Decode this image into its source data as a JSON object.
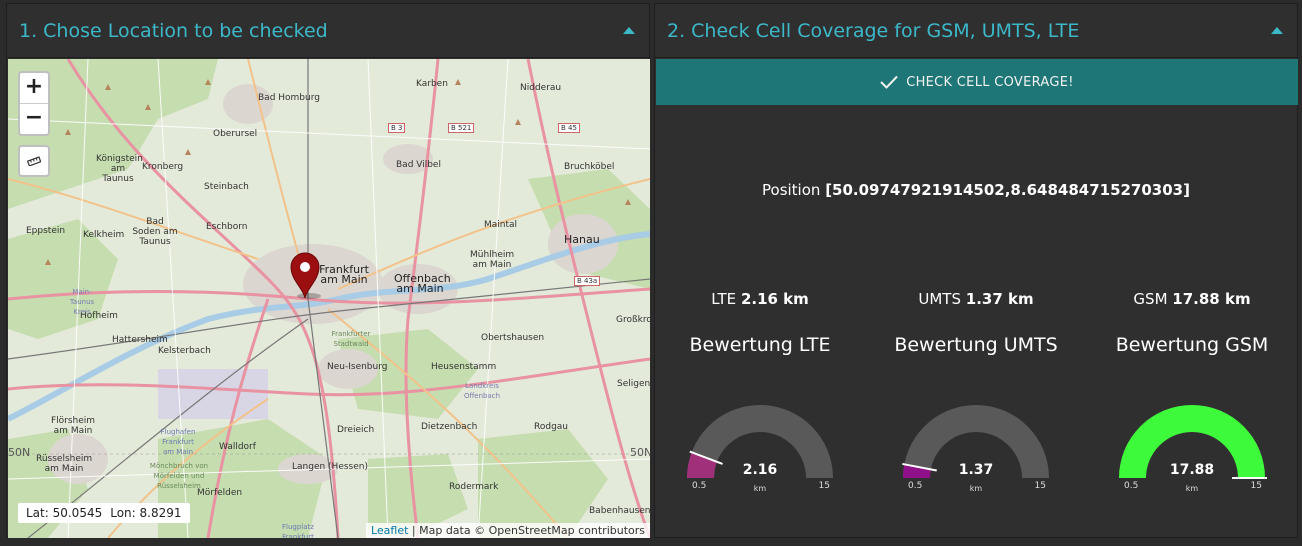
{
  "left_panel": {
    "title": "1. Chose Location to be checked",
    "zoom_in": "+",
    "zoom_out": "−",
    "coords": {
      "lat_label": "Lat: 50.0545",
      "lon_label": "Lon: 8.8291"
    },
    "attribution": {
      "link": "Leaflet",
      "text": "| Map data © OpenStreetMap contributors"
    },
    "map_labels": [
      "Karben",
      "Nidderau",
      "Bad Homburg",
      "Oberursel",
      "Königstein am Taunus",
      "Kronberg",
      "Bad Vilbel",
      "Bruchköbel",
      "Steinbach",
      "Eschborn",
      "Bad Soden am Taunus",
      "Eppstein",
      "Kelkheim",
      "Maintal",
      "Hanau",
      "Frankfurt am Main",
      "Offenbach am Main",
      "Mühlheim am Main",
      "Hofheim",
      "Hattersheim",
      "Kelsterbach",
      "Obertshausen",
      "Großkrotz",
      "Neu-Isenburg",
      "Heusenstamm",
      "Seligenstadt",
      "Flörsheim am Main",
      "Rüsselsheim am Main",
      "Walldorf",
      "Dreieich",
      "Dietzenbach",
      "Rodgau",
      "Langen (Hessen)",
      "Mörfelden",
      "Rodermark",
      "Babenhausen",
      "Flughafen Frankfurt am Main",
      "Frankfurter Stadtwald",
      "Main-Taunus Kreis",
      "Landkreis Offenbach",
      "Mönchbruch von Mörfelden und Rüsselsheim",
      "Flugplatz Frankfurt"
    ],
    "road_labels": [
      "B 3",
      "B 521",
      "B 45",
      "B 43a"
    ],
    "lat_lines": [
      "50N",
      "50N"
    ]
  },
  "right_panel": {
    "title": "2. Check Cell Coverage for GSM, UMTS, LTE",
    "check_button": "CHECK CELL COVERAGE!",
    "position_label": "Position",
    "position_value": "[50.09747921914502,8.648484715270303]",
    "metrics": [
      {
        "name": "LTE",
        "value": "2.16 km",
        "rating": "Bewertung LTE",
        "gauge_value": "2.16",
        "numeric": 2.16,
        "color": "#a0307a"
      },
      {
        "name": "UMTS",
        "value": "1.37 km",
        "rating": "Bewertung UMTS",
        "gauge_value": "1.37",
        "numeric": 1.37,
        "color": "#90108a"
      },
      {
        "name": "GSM",
        "value": "17.88 km",
        "rating": "Bewertung GSM",
        "gauge_value": "17.88",
        "numeric": 17.88,
        "color": "#3dfa3a"
      }
    ],
    "gauge_min": "0.5",
    "gauge_max": "15",
    "gauge_unit": "km"
  },
  "colors": {
    "accent": "#3cb8c9",
    "button": "#1f7677",
    "background": "#2f2f2f",
    "gauge_track": "#595959",
    "marker": "#9b0f10"
  }
}
